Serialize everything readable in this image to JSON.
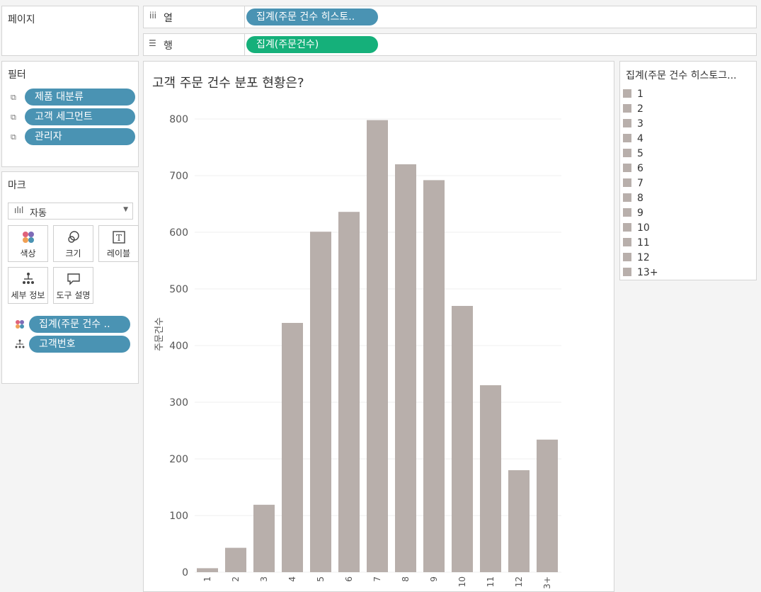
{
  "pages_panel": {
    "title": "페이지"
  },
  "columns_shelf": {
    "label": "열",
    "pill": "집계(주문 건수 히스토.."
  },
  "rows_shelf": {
    "label": "행",
    "pill": "집계(주문건수)"
  },
  "filters": {
    "title": "필터",
    "items": [
      "제품 대분류",
      "고객 세그먼트",
      "관리자"
    ]
  },
  "marks": {
    "title": "마크",
    "type_select": "자동",
    "buttons": [
      "색상",
      "크기",
      "레이블",
      "세부 정보",
      "도구 설명"
    ],
    "fields": [
      {
        "icon": "color-dots-icon",
        "label": "집계(주문 건수 .."
      },
      {
        "icon": "detail-icon",
        "label": "고객번호"
      }
    ]
  },
  "legend": {
    "title": "집계(주문 건수 히스토그...",
    "items": [
      "1",
      "2",
      "3",
      "4",
      "5",
      "6",
      "7",
      "8",
      "9",
      "10",
      "11",
      "12",
      "13+"
    ]
  },
  "colors": {
    "bar": "#b8afab",
    "pill_blue": "#4a93b3",
    "pill_green": "#15b07a"
  },
  "chart_data": {
    "type": "bar",
    "title": "고객 주문 건수 분포 현황은?",
    "ylabel": "주문건수",
    "xlabel": "",
    "categories": [
      "1",
      "2",
      "3",
      "4",
      "5",
      "6",
      "7",
      "8",
      "9",
      "10",
      "11",
      "12",
      "13+"
    ],
    "values": [
      7,
      43,
      119,
      440,
      601,
      636,
      798,
      720,
      692,
      470,
      330,
      180,
      234
    ],
    "ylim": [
      0,
      820
    ],
    "yticks": [
      0,
      100,
      200,
      300,
      400,
      500,
      600,
      700,
      800
    ],
    "grid": true
  }
}
